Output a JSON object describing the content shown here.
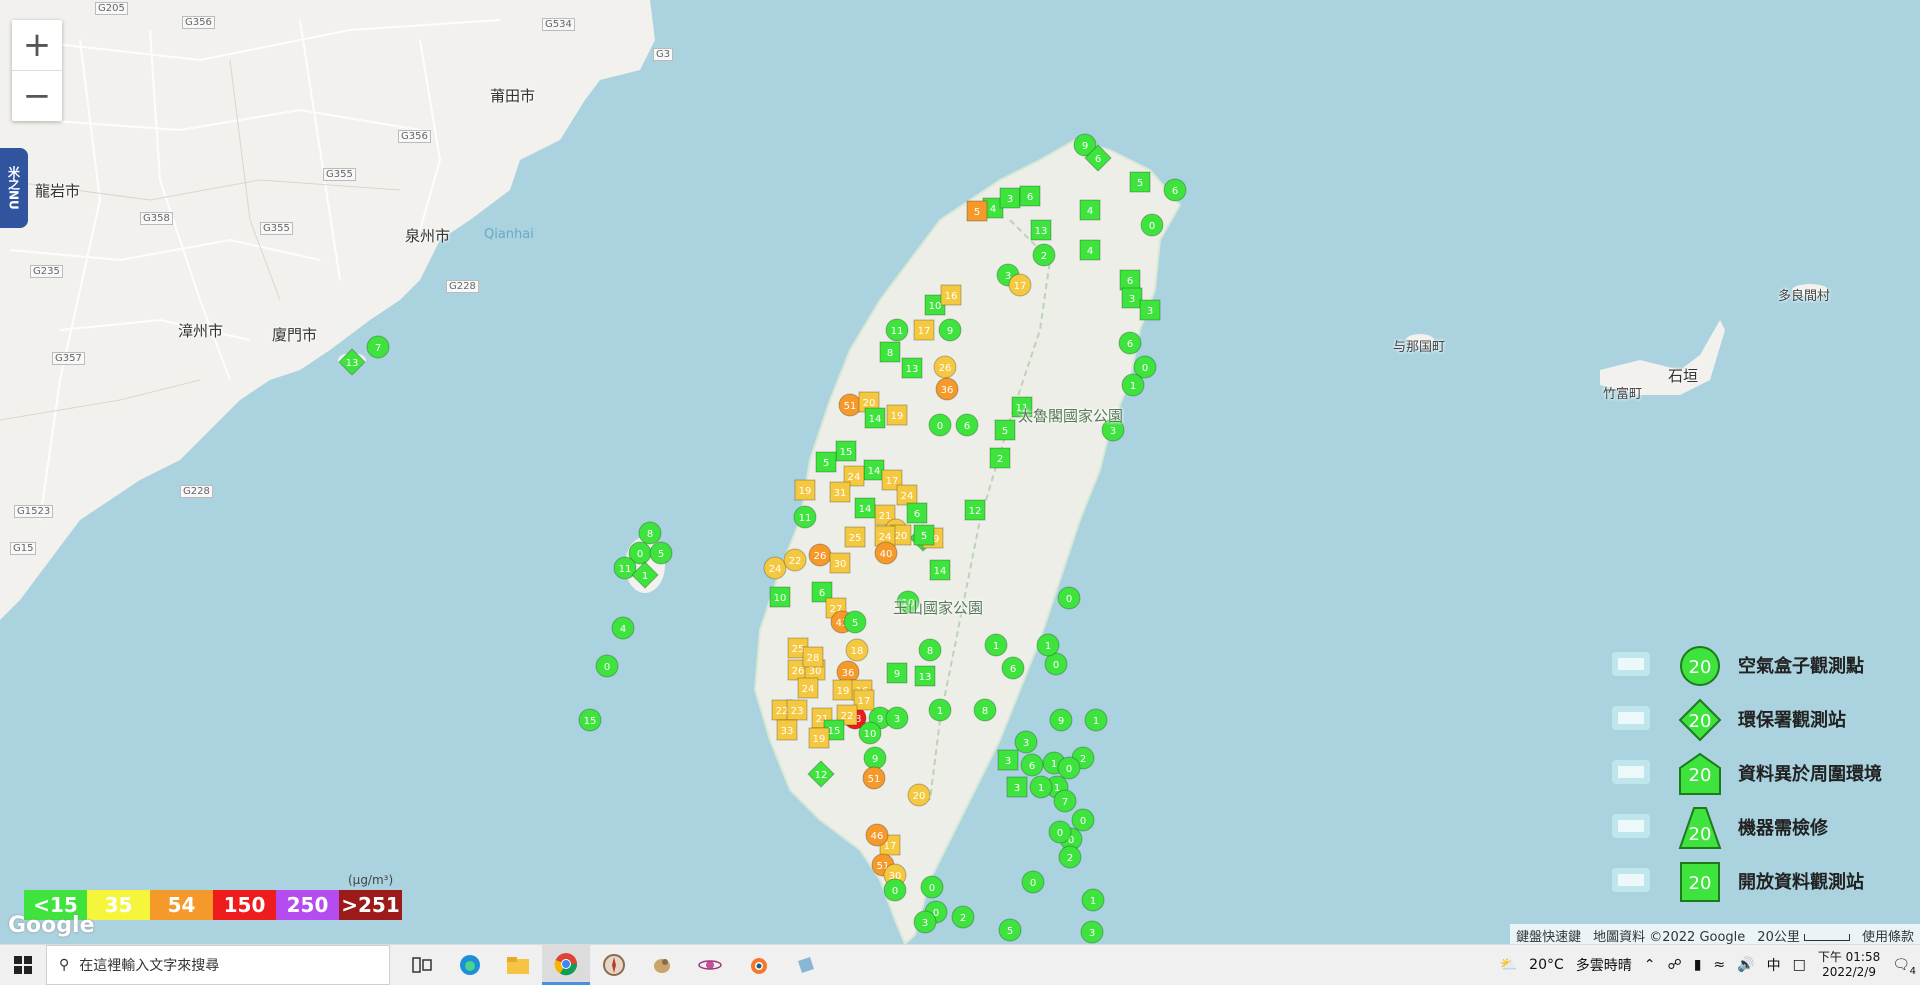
{
  "map": {
    "zoom_in_label": "+",
    "zoom_out_label": "−",
    "side_tab_label": "米之NU",
    "place_labels": [
      {
        "name": "莆田市",
        "kind": "city"
      },
      {
        "name": "龍岩市",
        "kind": "city"
      },
      {
        "name": "泉州市",
        "kind": "city"
      },
      {
        "name": "Qianhai",
        "kind": "sea"
      },
      {
        "name": "漳州市",
        "kind": "city"
      },
      {
        "name": "廈門市",
        "kind": "city"
      },
      {
        "name": "与那国町",
        "kind": "small"
      },
      {
        "name": "多良間村",
        "kind": "small"
      },
      {
        "name": "石垣",
        "kind": "city"
      },
      {
        "name": "竹富町",
        "kind": "small"
      },
      {
        "name": "太魯閣國家公園",
        "kind": "park"
      },
      {
        "name": "玉山國家公園",
        "kind": "park"
      }
    ],
    "road_labels": [
      "G205",
      "G356",
      "G534",
      "G3",
      "G356",
      "G355",
      "G358",
      "G355",
      "G235",
      "G357",
      "G228",
      "G1523",
      "G15",
      "G228"
    ]
  },
  "pm25_scale": {
    "unit": "(μg/m³)",
    "bands": [
      {
        "label": "<15",
        "color": "#3ee33e"
      },
      {
        "label": "35",
        "color": "#f5f53c"
      },
      {
        "label": "54",
        "color": "#f59a2a"
      },
      {
        "label": "150",
        "color": "#ee1c1c"
      },
      {
        "label": "250",
        "color": "#b44cf0"
      },
      {
        "label": ">251",
        "color": "#9c1a1a"
      }
    ]
  },
  "legend": [
    {
      "label": "空氣盒子觀測點",
      "marker": "circle",
      "icon": "cloud-box-icon",
      "value": "20"
    },
    {
      "label": "環保署觀測站",
      "marker": "diamond",
      "icon": "government-building-icon",
      "value": "20"
    },
    {
      "label": "資料異於周圍環境",
      "marker": "house",
      "icon": "house-icon",
      "value": "20"
    },
    {
      "label": "機器需檢修",
      "marker": "cone",
      "icon": "traffic-cone-icon",
      "value": "20"
    },
    {
      "label": "開放資料觀測站",
      "marker": "square",
      "icon": "open-data-icon",
      "value": "20"
    }
  ],
  "attribution": {
    "shortcuts": "鍵盤快速鍵",
    "map_data": "地圖資料 ©2022 Google",
    "scale": "20公里",
    "terms": "使用條款",
    "google_logo": "Google"
  },
  "taskbar": {
    "search_placeholder": "在這裡輸入文字來搜尋",
    "weather_temp": "20°C",
    "weather_desc": "多雲時晴",
    "ime": "中",
    "time": "下午 01:58",
    "date": "2022/2/9",
    "notifications": "4"
  },
  "markers": [
    {
      "v": "13",
      "t": "diamond",
      "c": "#3ee33e"
    },
    {
      "v": "7",
      "t": "circle",
      "c": "#3ee33e"
    },
    {
      "v": "8",
      "t": "circle",
      "c": "#3ee33e"
    },
    {
      "v": "0",
      "t": "circle",
      "c": "#3ee33e"
    },
    {
      "v": "5",
      "t": "circle",
      "c": "#3ee33e"
    },
    {
      "v": "11",
      "t": "circle",
      "c": "#3ee33e"
    },
    {
      "v": "1",
      "t": "diamond",
      "c": "#3ee33e"
    },
    {
      "v": "4",
      "t": "circle",
      "c": "#3ee33e"
    },
    {
      "v": "0",
      "t": "circle",
      "c": "#3ee33e"
    },
    {
      "v": "15",
      "t": "circle",
      "c": "#3ee33e"
    },
    {
      "v": "9",
      "t": "circle",
      "c": "#3ee33e"
    },
    {
      "v": "6",
      "t": "diamond",
      "c": "#3ee33e"
    },
    {
      "v": "5",
      "t": "square",
      "c": "#3ee33e"
    },
    {
      "v": "6",
      "t": "circle",
      "c": "#3ee33e"
    },
    {
      "v": "0",
      "t": "circle",
      "c": "#3ee33e"
    },
    {
      "v": "4",
      "t": "square",
      "c": "#3ee33e"
    },
    {
      "v": "3",
      "t": "square",
      "c": "#3ee33e"
    },
    {
      "v": "6",
      "t": "square",
      "c": "#3ee33e"
    },
    {
      "v": "5",
      "t": "square",
      "c": "#f59a2a"
    },
    {
      "v": "4",
      "t": "square",
      "c": "#3ee33e"
    },
    {
      "v": "13",
      "t": "square",
      "c": "#3ee33e"
    },
    {
      "v": "3",
      "t": "circle",
      "c": "#3ee33e"
    },
    {
      "v": "2",
      "t": "circle",
      "c": "#3ee33e"
    },
    {
      "v": "4",
      "t": "square",
      "c": "#3ee33e"
    },
    {
      "v": "6",
      "t": "square",
      "c": "#3ee33e"
    },
    {
      "v": "3",
      "t": "square",
      "c": "#3ee33e"
    },
    {
      "v": "3",
      "t": "square",
      "c": "#3ee33e"
    },
    {
      "v": "6",
      "t": "circle",
      "c": "#3ee33e"
    },
    {
      "v": "0",
      "t": "circle",
      "c": "#3ee33e"
    },
    {
      "v": "1",
      "t": "circle",
      "c": "#3ee33e"
    },
    {
      "v": "17",
      "t": "circle",
      "c": "#f5c842"
    },
    {
      "v": "10",
      "t": "square",
      "c": "#3ee33e"
    },
    {
      "v": "16",
      "t": "square",
      "c": "#f5c842"
    },
    {
      "v": "9",
      "t": "circle",
      "c": "#3ee33e"
    },
    {
      "v": "11",
      "t": "circle",
      "c": "#3ee33e"
    },
    {
      "v": "17",
      "t": "square",
      "c": "#f5c842"
    },
    {
      "v": "8",
      "t": "square",
      "c": "#3ee33e"
    },
    {
      "v": "13",
      "t": "square",
      "c": "#3ee33e"
    },
    {
      "v": "26",
      "t": "circle",
      "c": "#f5c842"
    },
    {
      "v": "36",
      "t": "circle",
      "c": "#f59a2a"
    },
    {
      "v": "51",
      "t": "circle",
      "c": "#f59a2a"
    },
    {
      "v": "20",
      "t": "square",
      "c": "#f5c842"
    },
    {
      "v": "14",
      "t": "square",
      "c": "#3ee33e"
    },
    {
      "v": "19",
      "t": "square",
      "c": "#f5c842"
    },
    {
      "v": "0",
      "t": "circle",
      "c": "#3ee33e"
    },
    {
      "v": "6",
      "t": "circle",
      "c": "#3ee33e"
    },
    {
      "v": "11",
      "t": "square",
      "c": "#3ee33e"
    },
    {
      "v": "5",
      "t": "square",
      "c": "#3ee33e"
    },
    {
      "v": "3",
      "t": "circle",
      "c": "#3ee33e"
    },
    {
      "v": "2",
      "t": "square",
      "c": "#3ee33e"
    },
    {
      "v": "15",
      "t": "square",
      "c": "#3ee33e"
    },
    {
      "v": "14",
      "t": "square",
      "c": "#3ee33e"
    },
    {
      "v": "24",
      "t": "square",
      "c": "#f5c842"
    },
    {
      "v": "5",
      "t": "square",
      "c": "#3ee33e"
    },
    {
      "v": "19",
      "t": "square",
      "c": "#f5c842"
    },
    {
      "v": "31",
      "t": "square",
      "c": "#f5c842"
    },
    {
      "v": "17",
      "t": "square",
      "c": "#f5c842"
    },
    {
      "v": "24",
      "t": "square",
      "c": "#f5c842"
    },
    {
      "v": "21",
      "t": "square",
      "c": "#f5c842"
    },
    {
      "v": "14",
      "t": "square",
      "c": "#3ee33e"
    },
    {
      "v": "28",
      "t": "circle",
      "c": "#f5c842"
    },
    {
      "v": "6",
      "t": "square",
      "c": "#3ee33e"
    },
    {
      "v": "12",
      "t": "square",
      "c": "#3ee33e"
    },
    {
      "v": "11",
      "t": "circle",
      "c": "#3ee33e"
    },
    {
      "v": "7",
      "t": "diamond",
      "c": "#3ee33e"
    },
    {
      "v": "29",
      "t": "square",
      "c": "#f5c842"
    },
    {
      "v": "20",
      "t": "square",
      "c": "#f5c842"
    },
    {
      "v": "25",
      "t": "square",
      "c": "#f5c842"
    },
    {
      "v": "24",
      "t": "square",
      "c": "#f5c842"
    },
    {
      "v": "5",
      "t": "square",
      "c": "#3ee33e"
    },
    {
      "v": "24",
      "t": "circle",
      "c": "#f5c842"
    },
    {
      "v": "22",
      "t": "circle",
      "c": "#f5c842"
    },
    {
      "v": "26",
      "t": "circle",
      "c": "#f59a2a"
    },
    {
      "v": "30",
      "t": "square",
      "c": "#f5c842"
    },
    {
      "v": "40",
      "t": "circle",
      "c": "#f59a2a"
    },
    {
      "v": "14",
      "t": "square",
      "c": "#3ee33e"
    },
    {
      "v": "10",
      "t": "square",
      "c": "#3ee33e"
    },
    {
      "v": "6",
      "t": "square",
      "c": "#3ee33e"
    },
    {
      "v": "27",
      "t": "square",
      "c": "#f5c842"
    },
    {
      "v": "43",
      "t": "circle",
      "c": "#f59a2a"
    },
    {
      "v": "5",
      "t": "circle",
      "c": "#3ee33e"
    },
    {
      "v": "10",
      "t": "circle",
      "c": "#3ee33e"
    },
    {
      "v": "25",
      "t": "square",
      "c": "#f5c842"
    },
    {
      "v": "26",
      "t": "square",
      "c": "#f5c842"
    },
    {
      "v": "30",
      "t": "square",
      "c": "#f5c842"
    },
    {
      "v": "24",
      "t": "square",
      "c": "#f5c842"
    },
    {
      "v": "36",
      "t": "circle",
      "c": "#f59a2a"
    },
    {
      "v": "18",
      "t": "circle",
      "c": "#f5c842"
    },
    {
      "v": "28",
      "t": "square",
      "c": "#f5c842"
    },
    {
      "v": "22",
      "t": "square",
      "c": "#f5c842"
    },
    {
      "v": "23",
      "t": "square",
      "c": "#f5c842"
    },
    {
      "v": "33",
      "t": "square",
      "c": "#f5c842"
    },
    {
      "v": "28",
      "t": "circle",
      "c": "#ee1c1c"
    },
    {
      "v": "9",
      "t": "circle",
      "c": "#3ee33e"
    },
    {
      "v": "10",
      "t": "circle",
      "c": "#3ee33e"
    },
    {
      "v": "3",
      "t": "circle",
      "c": "#3ee33e"
    },
    {
      "v": "9",
      "t": "circle",
      "c": "#3ee33e"
    },
    {
      "v": "8",
      "t": "circle",
      "c": "#3ee33e"
    },
    {
      "v": "13",
      "t": "square",
      "c": "#3ee33e"
    },
    {
      "v": "9",
      "t": "square",
      "c": "#3ee33e"
    },
    {
      "v": "19",
      "t": "square",
      "c": "#f5c842"
    },
    {
      "v": "16",
      "t": "square",
      "c": "#f5c842"
    },
    {
      "v": "17",
      "t": "square",
      "c": "#f5c842"
    },
    {
      "v": "21",
      "t": "square",
      "c": "#f5c842"
    },
    {
      "v": "22",
      "t": "square",
      "c": "#f5c842"
    },
    {
      "v": "15",
      "t": "square",
      "c": "#3ee33e"
    },
    {
      "v": "19",
      "t": "square",
      "c": "#f5c842"
    },
    {
      "v": "12",
      "t": "diamond",
      "c": "#3ee33e"
    },
    {
      "v": "51",
      "t": "circle",
      "c": "#f59a2a"
    },
    {
      "v": "20",
      "t": "circle",
      "c": "#f5c842"
    },
    {
      "v": "17",
      "t": "square",
      "c": "#f5c842"
    },
    {
      "v": "46",
      "t": "circle",
      "c": "#f59a2a"
    },
    {
      "v": "51",
      "t": "circle",
      "c": "#f59a2a"
    },
    {
      "v": "30",
      "t": "circle",
      "c": "#f5c842"
    },
    {
      "v": "0",
      "t": "circle",
      "c": "#3ee33e"
    },
    {
      "v": "0",
      "t": "circle",
      "c": "#3ee33e"
    },
    {
      "v": "1",
      "t": "circle",
      "c": "#3ee33e"
    },
    {
      "v": "9",
      "t": "circle",
      "c": "#3ee33e"
    },
    {
      "v": "1",
      "t": "circle",
      "c": "#3ee33e"
    },
    {
      "v": "2",
      "t": "circle",
      "c": "#3ee33e"
    },
    {
      "v": "1",
      "t": "circle",
      "c": "#3ee33e"
    },
    {
      "v": "1",
      "t": "circle",
      "c": "#3ee33e"
    },
    {
      "v": "7",
      "t": "circle",
      "c": "#3ee33e"
    },
    {
      "v": "0",
      "t": "circle",
      "c": "#3ee33e"
    },
    {
      "v": "0",
      "t": "circle",
      "c": "#3ee33e"
    },
    {
      "v": "2",
      "t": "circle",
      "c": "#3ee33e"
    },
    {
      "v": "1",
      "t": "circle",
      "c": "#3ee33e"
    },
    {
      "v": "3",
      "t": "circle",
      "c": "#3ee33e"
    },
    {
      "v": "0",
      "t": "circle",
      "c": "#3ee33e"
    },
    {
      "v": "0",
      "t": "circle",
      "c": "#3ee33e"
    },
    {
      "v": "0",
      "t": "circle",
      "c": "#3ee33e"
    },
    {
      "v": "5",
      "t": "circle",
      "c": "#3ee33e"
    },
    {
      "v": "0",
      "t": "circle",
      "c": "#3ee33e"
    },
    {
      "v": "3",
      "t": "circle",
      "c": "#3ee33e"
    },
    {
      "v": "2",
      "t": "circle",
      "c": "#3ee33e"
    },
    {
      "v": "8",
      "t": "circle",
      "c": "#3ee33e"
    },
    {
      "v": "3",
      "t": "circle",
      "c": "#3ee33e"
    },
    {
      "v": "0",
      "t": "circle",
      "c": "#3ee33e"
    },
    {
      "v": "1",
      "t": "circle",
      "c": "#3ee33e"
    },
    {
      "v": "0",
      "t": "circle",
      "c": "#3ee33e"
    },
    {
      "v": "1",
      "t": "circle",
      "c": "#3ee33e"
    },
    {
      "v": "6",
      "t": "circle",
      "c": "#3ee33e"
    },
    {
      "v": "3",
      "t": "square",
      "c": "#3ee33e"
    },
    {
      "v": "3",
      "t": "square",
      "c": "#3ee33e"
    },
    {
      "v": "6",
      "t": "circle",
      "c": "#3ee33e"
    },
    {
      "v": "1",
      "t": "circle",
      "c": "#3ee33e"
    }
  ]
}
